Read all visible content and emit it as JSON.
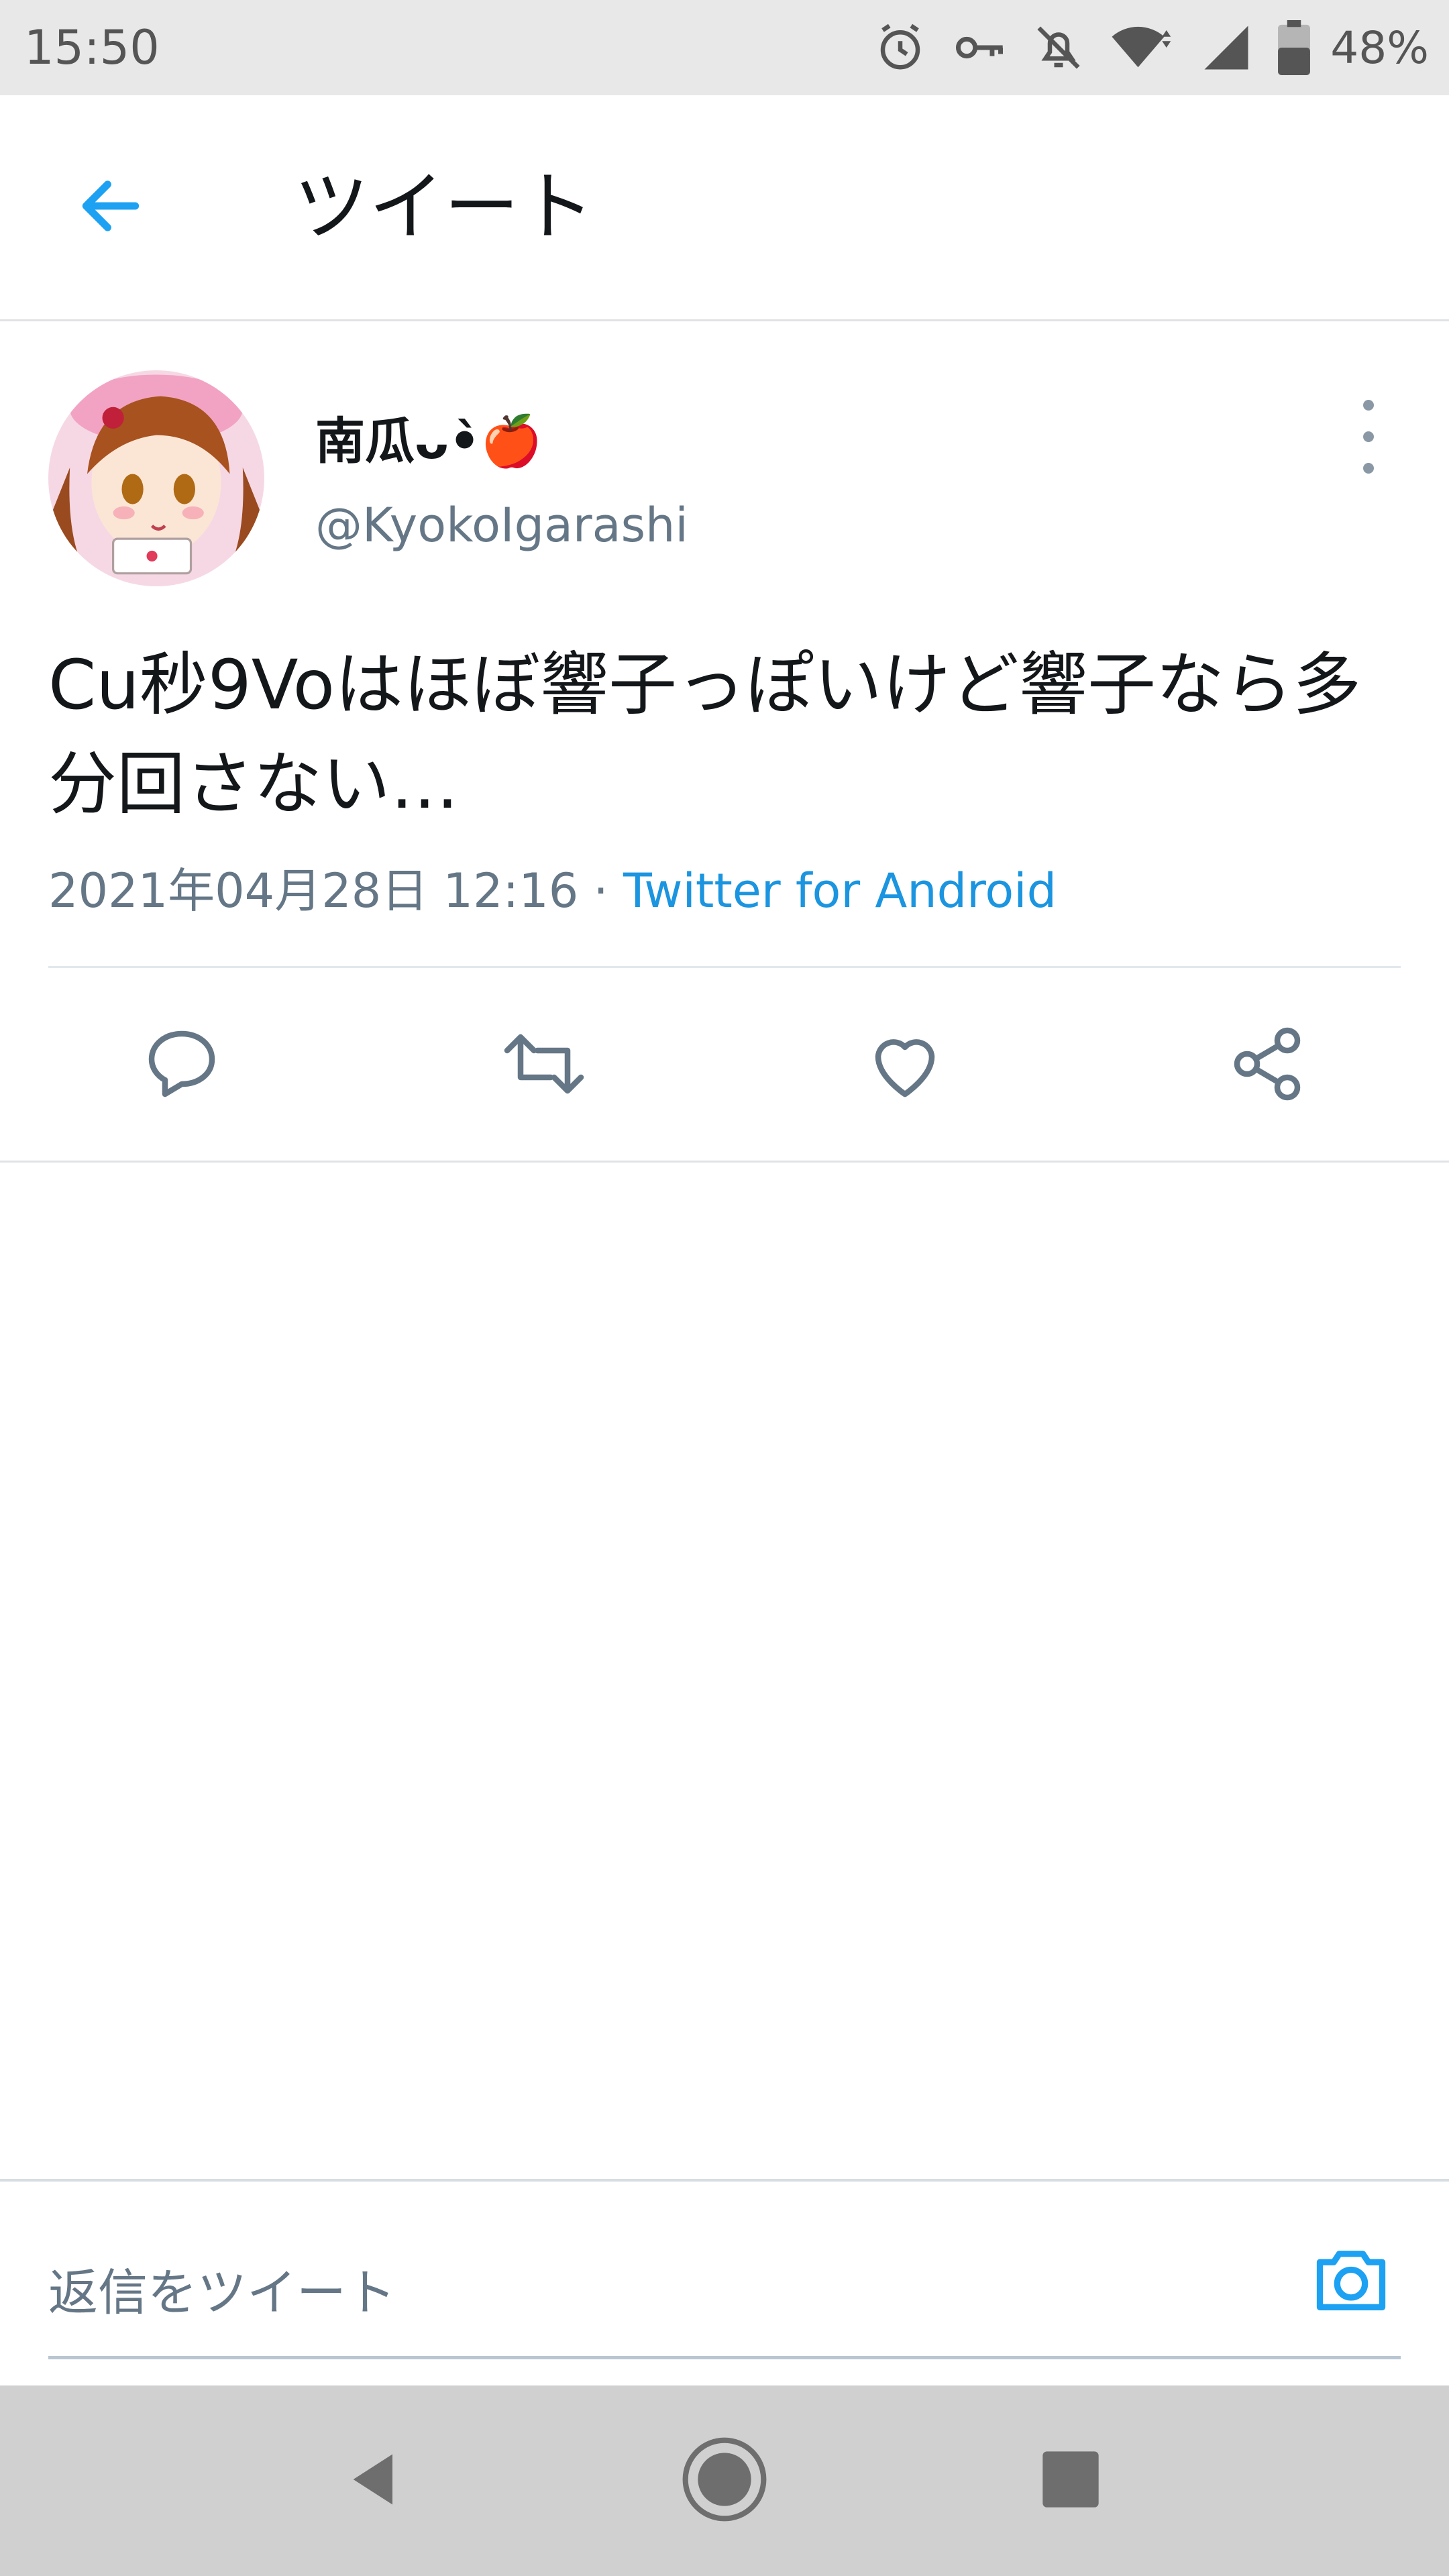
{
  "status_bar": {
    "time": "15:50",
    "battery_percent": "48%",
    "icons": [
      "alarm-icon",
      "vpn-key-icon",
      "notifications-off-icon",
      "wifi-icon",
      "cell-signal-icon",
      "battery-icon"
    ]
  },
  "header": {
    "title": "ツイート",
    "back_icon": "arrow-left-icon"
  },
  "tweet": {
    "display_name": "南瓜ᴗ•̀🍎",
    "handle": "@KyokoIgarashi",
    "text": "Cu秒9Voはほぼ響子っぽいけど響子なら多分回さない…",
    "timestamp": "2021年04月28日 12:16",
    "separator": " · ",
    "source": "Twitter for Android",
    "avatar": "avatar-image"
  },
  "actions": [
    {
      "name": "reply",
      "icon": "comment-icon"
    },
    {
      "name": "retweet",
      "icon": "retweet-icon"
    },
    {
      "name": "like",
      "icon": "heart-icon"
    },
    {
      "name": "share",
      "icon": "share-icon"
    }
  ],
  "reply_bar": {
    "placeholder": "返信をツイート",
    "camera_icon": "camera-icon"
  },
  "nav_bar": {
    "icons": [
      "back-triangle-icon",
      "home-circle-icon",
      "recents-square-icon"
    ]
  },
  "colors": {
    "accent": "#1da1f2",
    "link": "#1b95e0",
    "secondary_text": "#657786",
    "icon_gray": "#657786"
  }
}
